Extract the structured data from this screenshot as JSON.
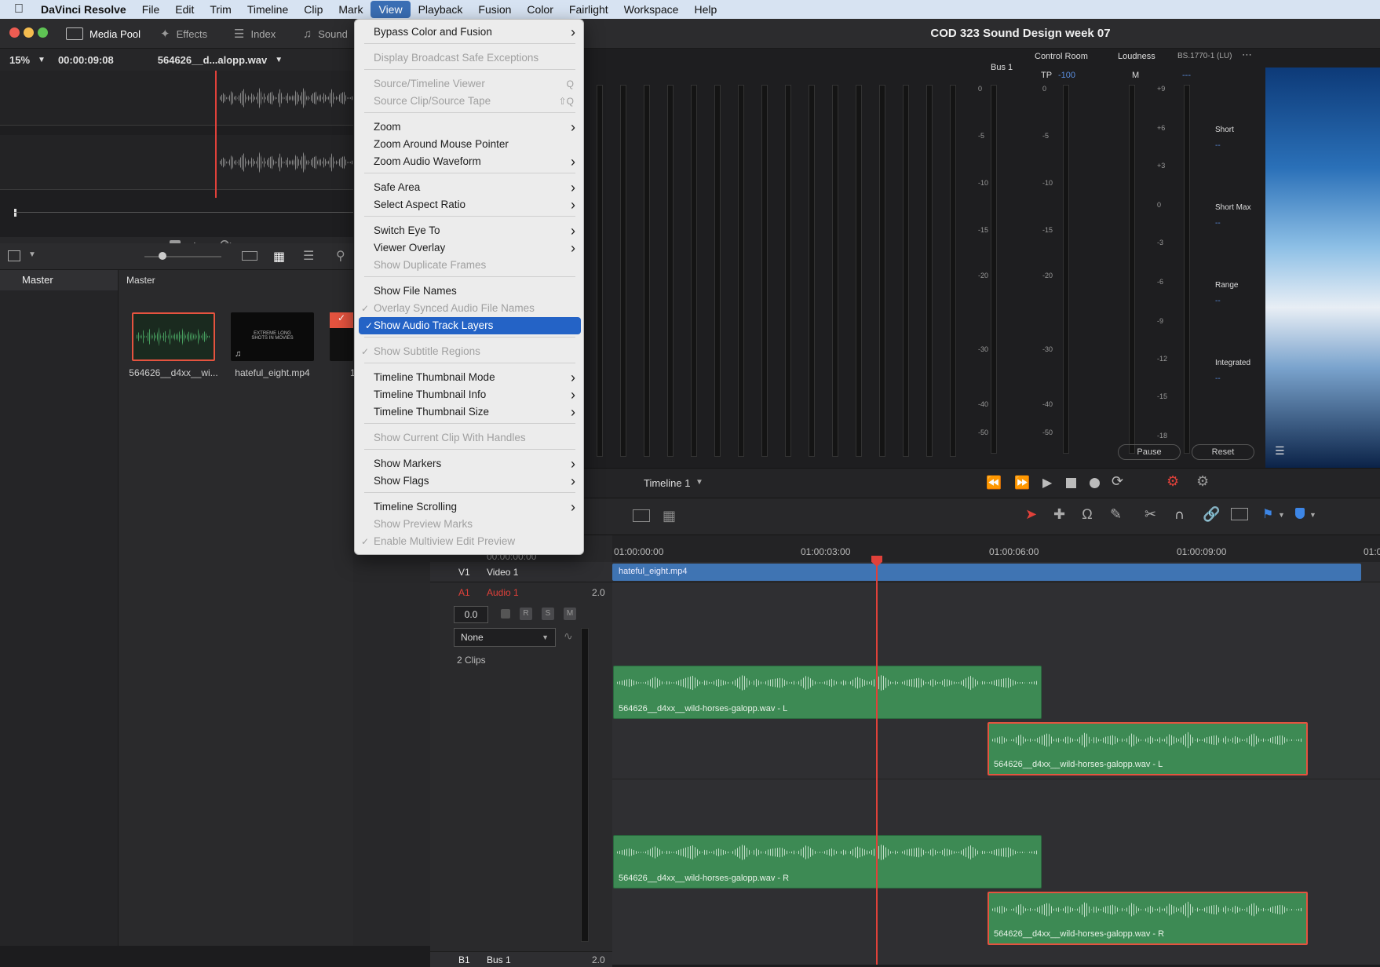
{
  "menubar": {
    "app_name": "DaVinci Resolve",
    "items": [
      "File",
      "Edit",
      "Trim",
      "Timeline",
      "Clip",
      "Mark",
      "View",
      "Playback",
      "Fusion",
      "Color",
      "Fairlight",
      "Workspace",
      "Help"
    ]
  },
  "toolbar": {
    "media_pool": "Media Pool",
    "effects": "Effects",
    "index": "Index",
    "sound": "Sound"
  },
  "project_title": "COD 323 Sound Design week 07",
  "source_viewer": {
    "zoom": "15%",
    "timecode": "00:00:09:08",
    "clip_name": "564626__d...alopp.wav"
  },
  "media_pool": {
    "sidebar_master": "Master",
    "content_master": "Master",
    "clips": [
      {
        "label": "564626__d4xx__wi..."
      },
      {
        "label": "hateful_eight.mp4"
      },
      {
        "label": "1"
      }
    ],
    "thumb_text": "EXTREME LONG SHOTS IN MOVIES"
  },
  "view_menu": {
    "items": [
      {
        "label": "Bypass Color and Fusion",
        "submenu": true
      },
      {
        "label": "Display Broadcast Safe Exceptions",
        "disabled": true
      },
      {
        "label": "Source/Timeline Viewer",
        "disabled": true,
        "shortcut": "Q"
      },
      {
        "label": "Source Clip/Source Tape",
        "disabled": true,
        "shortcut": "⇧Q"
      },
      {
        "label": "Zoom",
        "submenu": true
      },
      {
        "label": "Zoom Around Mouse Pointer"
      },
      {
        "label": "Zoom Audio Waveform",
        "submenu": true
      },
      {
        "label": "Safe Area",
        "submenu": true
      },
      {
        "label": "Select Aspect Ratio",
        "submenu": true
      },
      {
        "label": "Switch Eye To",
        "submenu": true
      },
      {
        "label": "Viewer Overlay",
        "submenu": true
      },
      {
        "label": "Show Duplicate Frames",
        "disabled": true
      },
      {
        "label": "Show File Names"
      },
      {
        "label": "Overlay Synced Audio File Names",
        "disabled": true,
        "checked": true
      },
      {
        "label": "Show Audio Track Layers",
        "checked": true,
        "highlighted": true
      },
      {
        "label": "Show Subtitle Regions",
        "disabled": true,
        "checked": true
      },
      {
        "label": "Timeline Thumbnail Mode",
        "submenu": true
      },
      {
        "label": "Timeline Thumbnail Info",
        "submenu": true
      },
      {
        "label": "Timeline Thumbnail Size",
        "submenu": true
      },
      {
        "label": "Show Current Clip With Handles",
        "disabled": true
      },
      {
        "label": "Show Markers",
        "submenu": true
      },
      {
        "label": "Show Flags",
        "submenu": true
      },
      {
        "label": "Timeline Scrolling",
        "submenu": true
      },
      {
        "label": "Show Preview Marks",
        "disabled": true
      },
      {
        "label": "Enable Multiview Edit Preview",
        "disabled": true,
        "checked": true
      }
    ]
  },
  "meters": {
    "bus_label": "Bus 1",
    "control_room": "Control Room",
    "tp_label": "TP",
    "tp_value": "-100",
    "loudness": "Loudness",
    "standard": "BS.1770-1 (LU)",
    "m_label": "M",
    "m_value": "---",
    "scale_left": [
      "0",
      "-5",
      "-10",
      "-15",
      "-20",
      "-30",
      "-40",
      "-50"
    ],
    "scale_lu": [
      "+9",
      "+6",
      "+3",
      "0",
      "-3",
      "-6",
      "-9",
      "-12",
      "-15",
      "-18"
    ],
    "short": "Short",
    "short_max": "Short Max",
    "range": "Range",
    "integrated": "Integrated",
    "dash": "--",
    "pause": "Pause",
    "reset": "Reset"
  },
  "timeline": {
    "name": "Timeline 1",
    "start_tc": "00:00:00:00",
    "ruler": [
      "01:00:00:00",
      "01:00:03:00",
      "01:00:06:00",
      "01:00:09:00",
      "01:0"
    ],
    "v1": "V1",
    "video_track": "Video 1",
    "a1": "A1",
    "audio_track": "Audio 1",
    "audio_ch": "2.0",
    "volume": "0.0",
    "r": "R",
    "s": "S",
    "m": "M",
    "effect": "None",
    "clips_count": "2 Clips",
    "b1": "B1",
    "bus_track": "Bus 1",
    "bus_ch": "2.0",
    "video_clip": "hateful_eight.mp4",
    "audio_clips": [
      {
        "label": "564626__d4xx__wild-horses-galopp.wav - L"
      },
      {
        "label": "564626__d4xx__wild-horses-galopp.wav - L"
      },
      {
        "label": "564626__d4xx__wild-horses-galopp.wav - R"
      },
      {
        "label": "564626__d4xx__wild-horses-galopp.wav - R"
      }
    ]
  }
}
